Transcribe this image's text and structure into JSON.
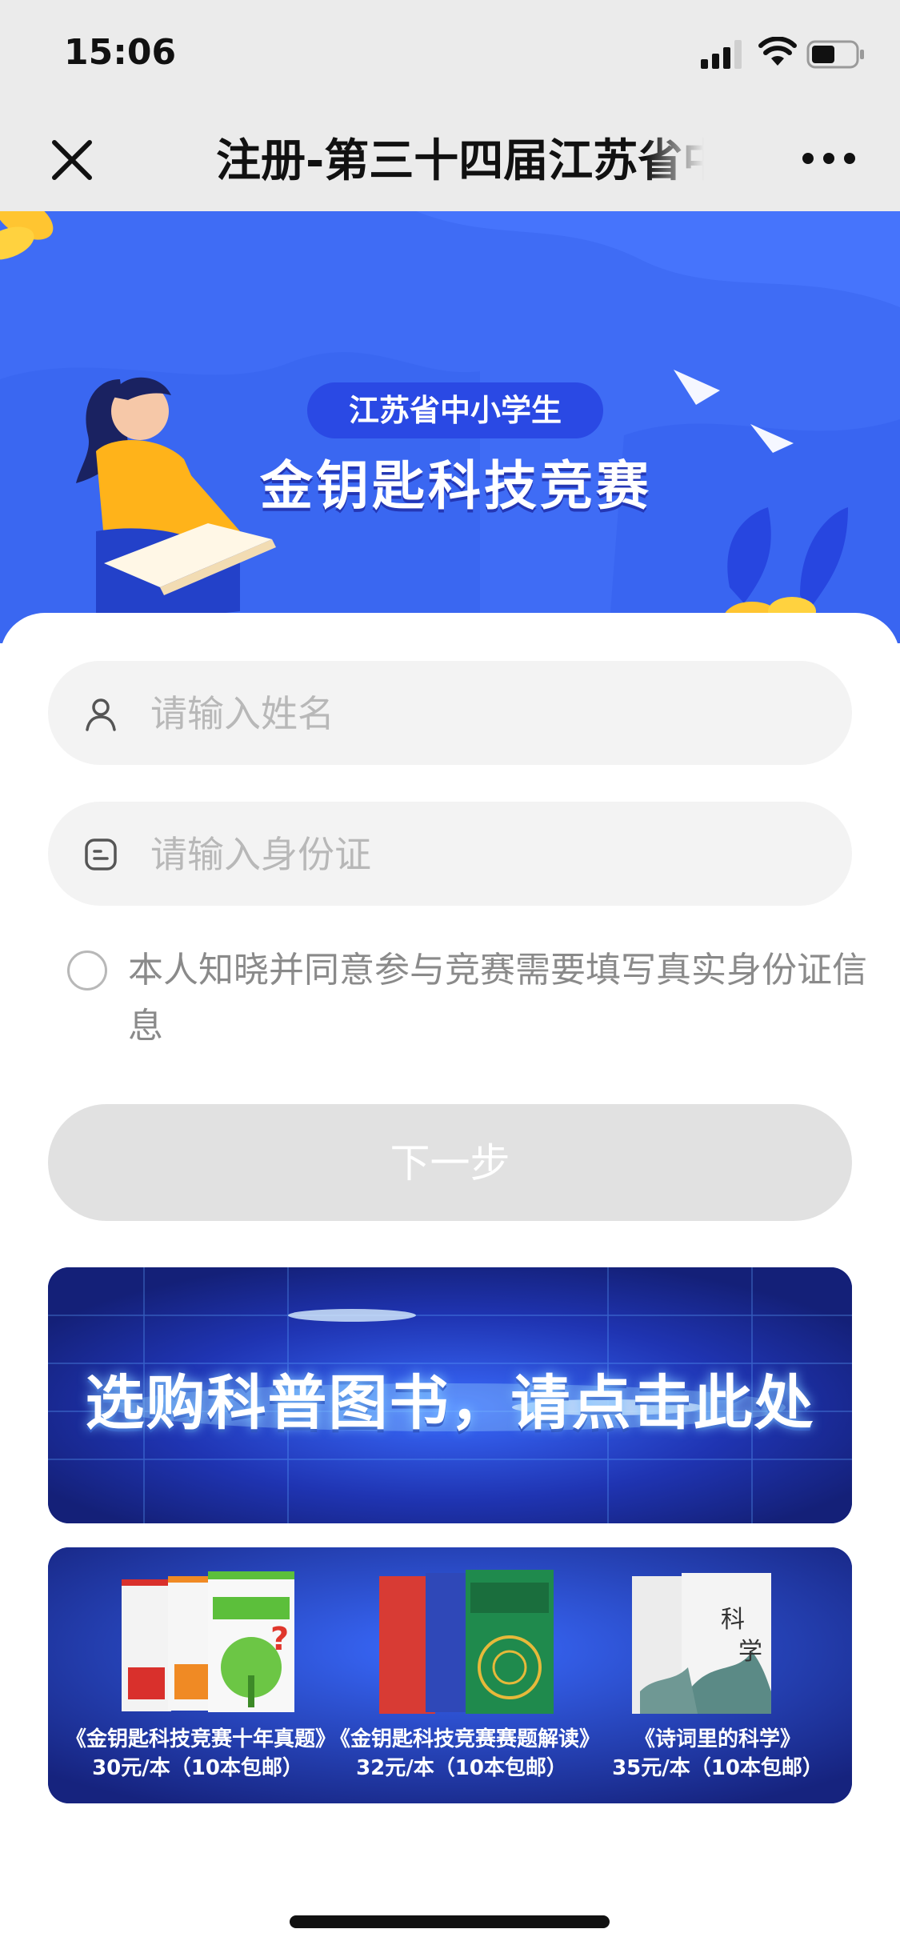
{
  "status_bar": {
    "time": "15:06"
  },
  "nav": {
    "title": "注册-第三十四届江苏省中小学生金钥匙科技竞赛",
    "close_icon": "close-icon",
    "more_icon": "more-icon"
  },
  "hero": {
    "subtitle": "江苏省中小学生",
    "title": "金钥匙科技竞赛",
    "colors": {
      "background": "#3f6cf5",
      "pill": "#2a49e4"
    }
  },
  "form": {
    "name_placeholder": "请输入姓名",
    "id_placeholder": "请输入身份证",
    "agree_text": "本人知晓并同意参与竞赛需要填写真实身份证信息",
    "next_label": "下一步"
  },
  "promo": {
    "banner_text": "选购科普图书，请点击此处",
    "books": [
      {
        "title": "《金钥匙科技竞赛十年真题》",
        "price": "30元/本（10本包邮）"
      },
      {
        "title": "《金钥匙科技竞赛赛题解读》",
        "price": "32元/本（10本包邮）"
      },
      {
        "title": "《诗词里的科学》",
        "price": "35元/本（10本包邮）"
      }
    ]
  }
}
